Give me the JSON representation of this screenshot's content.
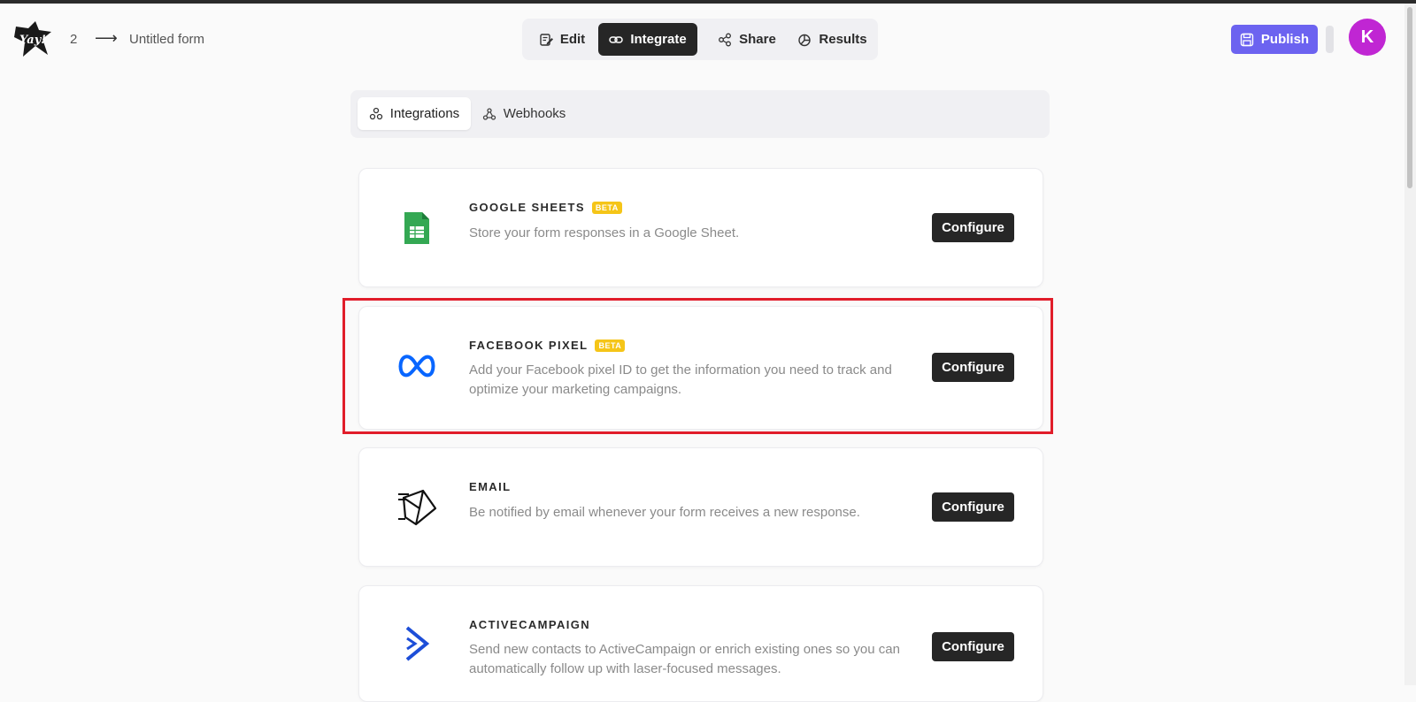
{
  "header": {
    "logo_text": "Yay!",
    "breadcrumb_number": "2",
    "breadcrumb_arrow": "⟶",
    "form_title": "Untitled form",
    "nav_tabs": [
      {
        "label": "Edit",
        "icon": "edit-icon",
        "active": false
      },
      {
        "label": "Integrate",
        "icon": "link-icon",
        "active": true
      },
      {
        "label": "Share",
        "icon": "share-icon",
        "active": false
      },
      {
        "label": "Results",
        "icon": "pie-chart-icon",
        "active": false
      }
    ],
    "publish_label": "Publish",
    "avatar_initial": "K"
  },
  "subtabs": [
    {
      "label": "Integrations",
      "icon": "integrations-icon",
      "active": true
    },
    {
      "label": "Webhooks",
      "icon": "webhook-icon",
      "active": false
    }
  ],
  "integrations": [
    {
      "title": "GOOGLE SHEETS",
      "beta": "BETA",
      "description": "Store your form responses in a Google Sheet.",
      "button": "Configure",
      "icon": "google-sheets-icon"
    },
    {
      "title": "FACEBOOK PIXEL",
      "beta": "BETA",
      "description": "Add your Facebook pixel ID to get the information you need to track and optimize your marketing campaigns.",
      "button": "Configure",
      "icon": "meta-icon",
      "highlighted": true
    },
    {
      "title": "EMAIL",
      "description": "Be notified by email whenever your form receives a new response.",
      "button": "Configure",
      "icon": "email-icon"
    },
    {
      "title": "ACTIVECAMPAIGN",
      "description": "Send new contacts to ActiveCampaign or enrich existing ones so you can automatically follow up with laser-focused messages.",
      "button": "Configure",
      "icon": "activecampaign-icon"
    }
  ],
  "colors": {
    "accent_purple": "#6c63f0",
    "avatar": "#c026d3",
    "beta_badge": "#f5c518",
    "highlight_red": "#e11d2a",
    "dark_button": "#262626"
  }
}
